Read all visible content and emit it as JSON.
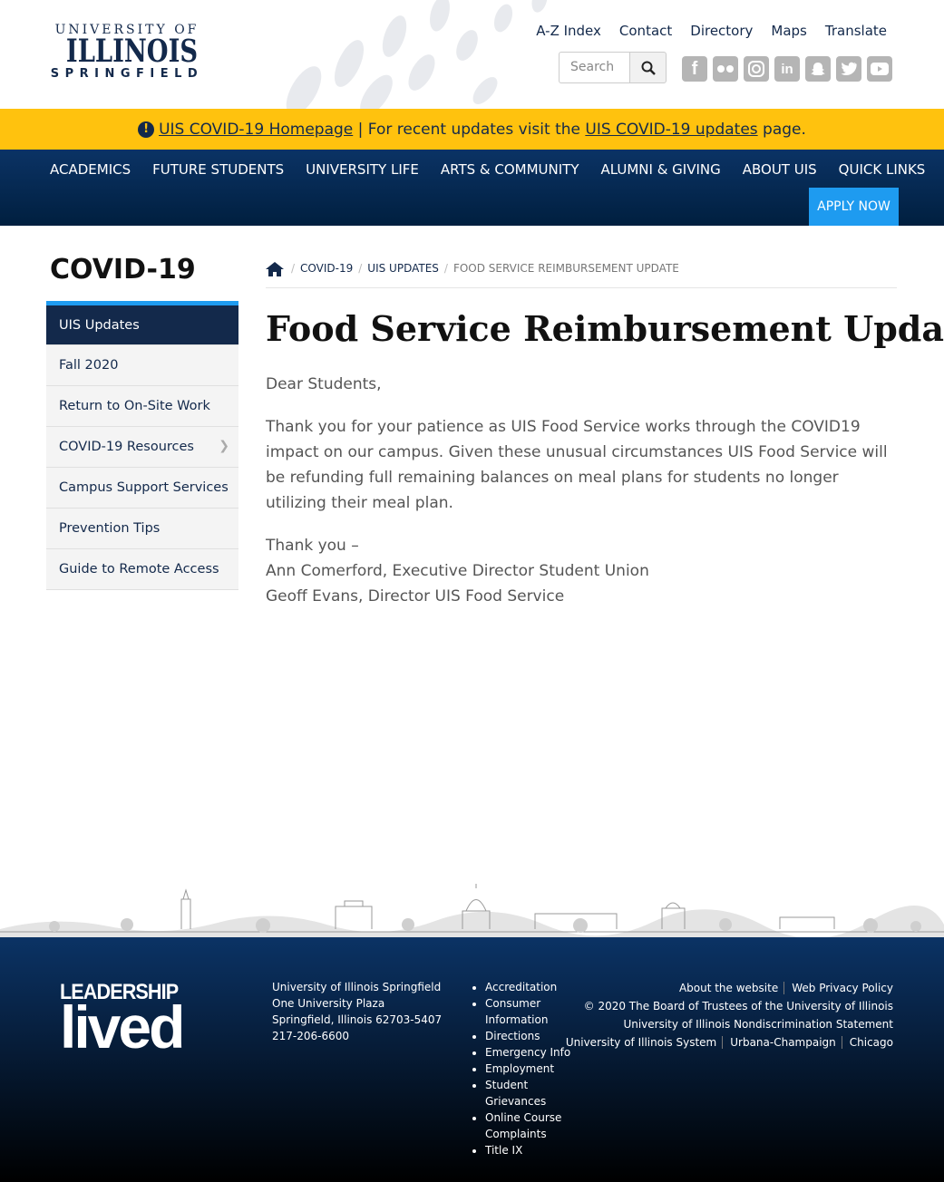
{
  "logo": {
    "line1": "UNIVERSITY OF",
    "line2": "ILLINOIS",
    "line3": "SPRINGFIELD"
  },
  "utility_links": [
    "A-Z Index",
    "Contact",
    "Directory",
    "Maps",
    "Translate"
  ],
  "search": {
    "placeholder": "Search"
  },
  "social": [
    "facebook-icon",
    "flickr-icon",
    "instagram-icon",
    "linkedin-icon",
    "snapchat-icon",
    "twitter-icon",
    "youtube-icon"
  ],
  "alert": {
    "link1": "UIS COVID-19 Homepage",
    "middle": " | For recent updates visit the ",
    "link2": "UIS COVID-19 updates",
    "end": " page."
  },
  "nav": {
    "items": [
      "ACADEMICS",
      "FUTURE STUDENTS",
      "UNIVERSITY LIFE",
      "ARTS & COMMUNITY",
      "ALUMNI & GIVING",
      "ABOUT UIS",
      "QUICK LINKS"
    ],
    "apply": "APPLY NOW"
  },
  "sidebar": {
    "title": "COVID-19",
    "items": [
      "UIS Updates",
      "Fall 2020",
      "Return to On-Site Work",
      "COVID-19 Resources",
      "Campus Support Services",
      "Prevention Tips",
      "Guide to Remote Access"
    ]
  },
  "breadcrumb": {
    "items": [
      "COVID-19",
      "UIS UPDATES"
    ],
    "current": "FOOD SERVICE REIMBURSEMENT UPDATE"
  },
  "page": {
    "title": "Food Service Reimbursement Update",
    "salutation": "Dear Students,",
    "paragraph": "Thank you for your patience as UIS Food Service works through the COVID19 impact on our campus. Given these unusual circumstances UIS Food Service will be refunding full remaining balances on meal plans for students no longer utilizing their meal plan.",
    "closing": "Thank you –",
    "signer1": "Ann Comerford, Executive Director Student Union",
    "signer2": "Geoff Evans, Director UIS Food Service"
  },
  "footer": {
    "logo_a": "LEADERSHIP",
    "logo_b": "lived",
    "address": [
      "University of Illinois Springfield",
      "One University Plaza",
      "Springfield, Illinois 62703-5407",
      "217-206-6600"
    ],
    "links": [
      "Accreditation",
      "Consumer Information",
      "Directions",
      "Emergency Info",
      "Employment",
      "Student Grievances",
      "Online Course Complaints",
      "Title IX"
    ],
    "right": {
      "about": "About the website",
      "privacy": "Web Privacy Policy",
      "copyright": "© 2020 The Board of Trustees of the University of Illinois",
      "nondiscrimination": "University of Illinois Nondiscrimination Statement",
      "system": "University of Illinois System",
      "urbana": "Urbana-Champaign",
      "chicago": "Chicago"
    }
  },
  "colors": {
    "navy": "#13294b",
    "gold": "#ffc20e",
    "blue": "#1e9bf0"
  }
}
